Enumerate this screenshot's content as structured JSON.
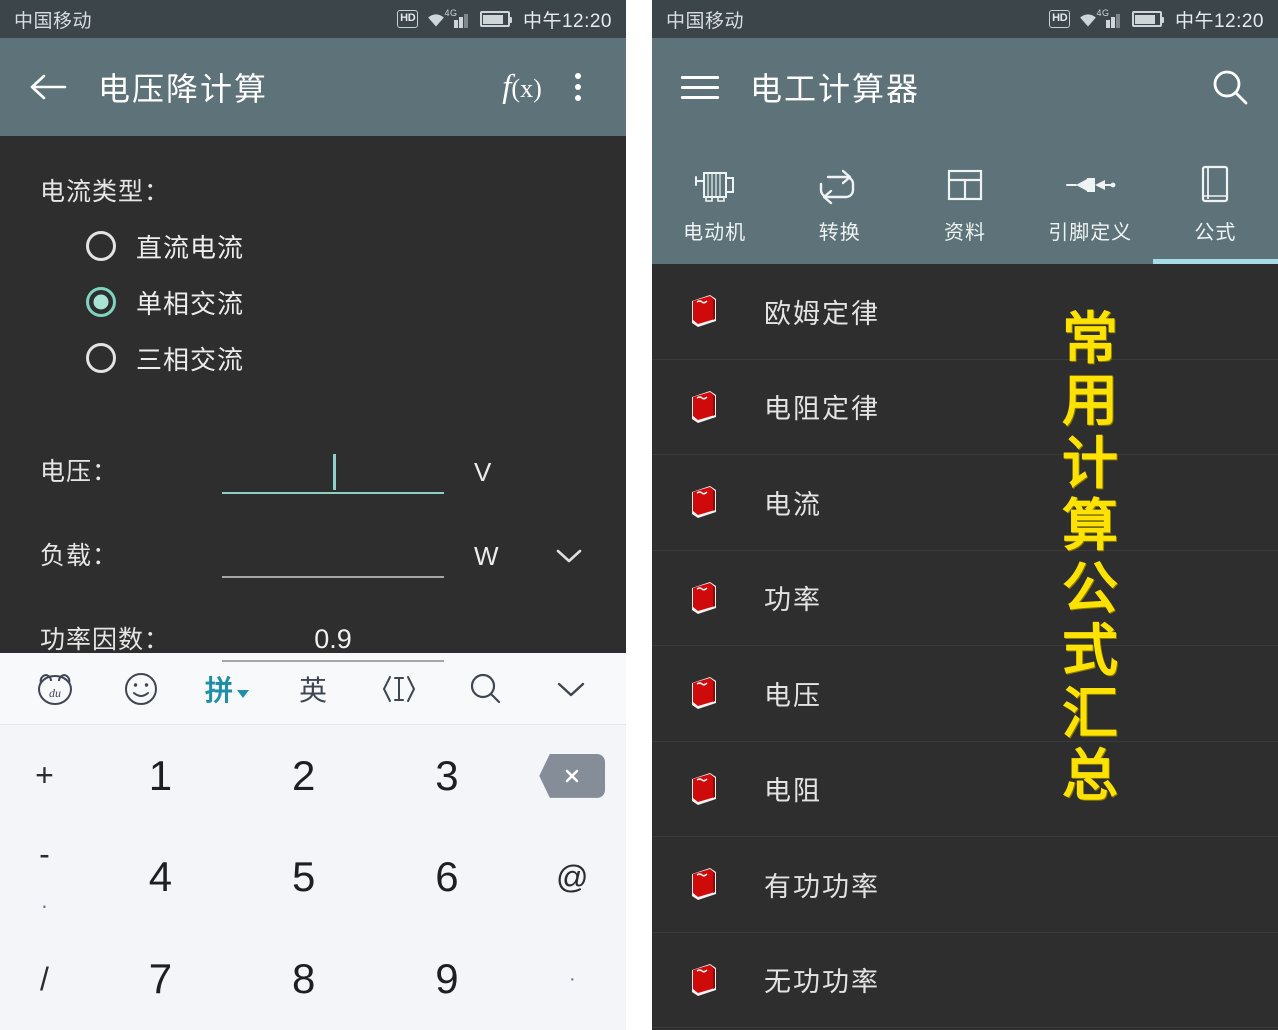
{
  "status_bar": {
    "carrier": "中国移动",
    "hd_badge": "HD",
    "network": "4G",
    "time": "中午12:20"
  },
  "left_panel": {
    "appbar": {
      "back_icon": "arrow-left-icon",
      "title": "电压降计算",
      "formula_icon_main": "f",
      "formula_icon_paren": "(x)",
      "overflow_icon": "more-vertical-icon"
    },
    "form": {
      "current_type_label": "电流类型：",
      "radios": [
        {
          "label": "直流电流",
          "selected": false
        },
        {
          "label": "单相交流",
          "selected": true
        },
        {
          "label": "三相交流",
          "selected": false
        }
      ],
      "fields": [
        {
          "name": "电压：",
          "value": "",
          "unit": "V",
          "focused": true,
          "has_dropdown": false
        },
        {
          "name": "负载：",
          "value": "",
          "unit": "W",
          "focused": false,
          "has_dropdown": true
        },
        {
          "name": "功率因数：",
          "value": "0.9",
          "unit": "",
          "focused": false,
          "has_dropdown": false
        }
      ]
    },
    "keyboard": {
      "toolbar": [
        {
          "name": "baidu-bear-icon",
          "label": "du",
          "active": false
        },
        {
          "name": "emoji-icon",
          "label": "",
          "active": false
        },
        {
          "name": "pinyin-mode",
          "label": "拼",
          "active": true
        },
        {
          "name": "english-mode",
          "label": "英",
          "active": false
        },
        {
          "name": "cursor-move-icon",
          "label": "",
          "active": false
        },
        {
          "name": "search-icon",
          "label": "",
          "active": false
        },
        {
          "name": "collapse-keyboard-icon",
          "label": "",
          "active": false
        }
      ],
      "keys": {
        "left_column": [
          "+",
          "-",
          "·",
          "/"
        ],
        "rows": [
          [
            "1",
            "2",
            "3"
          ],
          [
            "4",
            "5",
            "6"
          ],
          [
            "7",
            "8",
            "9"
          ]
        ],
        "right_column": [
          "backspace",
          "@",
          "·"
        ]
      }
    }
  },
  "right_panel": {
    "appbar": {
      "menu_icon": "hamburger-icon",
      "title": "电工计算器",
      "search_icon": "search-icon"
    },
    "tabs": [
      {
        "label": "电动机",
        "icon": "motor-icon",
        "active": false
      },
      {
        "label": "转换",
        "icon": "convert-icon",
        "active": false
      },
      {
        "label": "资料",
        "icon": "table-icon",
        "active": false
      },
      {
        "label": "引脚定义",
        "icon": "pinout-icon",
        "active": false
      },
      {
        "label": "公式",
        "icon": "book-icon",
        "active": true
      }
    ],
    "formula_list": [
      {
        "label": "欧姆定律"
      },
      {
        "label": "电阻定律"
      },
      {
        "label": "电流"
      },
      {
        "label": "功率"
      },
      {
        "label": "电压"
      },
      {
        "label": "电阻"
      },
      {
        "label": "有功功率"
      },
      {
        "label": "无功功率"
      }
    ],
    "overlay_caption": "常用计算公式汇总"
  },
  "colors": {
    "appbar": "#5e7279",
    "status_bar": "#3b454a",
    "body": "#2e2e2e",
    "accent_teal": "#8fd0c4",
    "tab_underline": "#a8dbe8",
    "caption_yellow": "#ffe200",
    "keyboard_bg": "#f4f5f9",
    "pinyin_active": "#1f8fa8"
  }
}
